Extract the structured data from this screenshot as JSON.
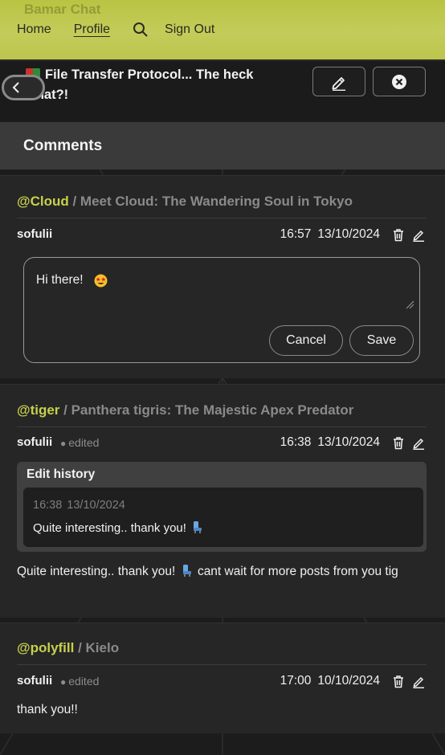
{
  "nav": {
    "ghost_text": "Bamar Chat",
    "links": [
      "Home",
      "Profile"
    ],
    "sign_out": "Sign Out",
    "accent": "#c3cc5a"
  },
  "post": {
    "title": "File Transfer Protocol... The heck what?!"
  },
  "comments_section": {
    "title": "Comments"
  },
  "comments": [
    {
      "tag": "@Cloud",
      "post_title": "Meet Cloud: The Wandering Soul in Tokyo",
      "author": "sofulii",
      "edited": "",
      "time": "16:57",
      "date": "13/10/2024",
      "editing": {
        "value": "Hi there!",
        "cancel_label": "Cancel",
        "save_label": "Save"
      }
    },
    {
      "tag": "@tiger",
      "post_title": "Panthera tigris: The Majestic Apex Predator",
      "author": "sofulii",
      "edited": "edited",
      "time": "16:38",
      "date": "13/10/2024",
      "history": {
        "title": "Edit history",
        "entries": [
          {
            "time": "16:38",
            "date": "13/10/2024",
            "text": "Quite interesting.. thank you!"
          }
        ]
      },
      "body_before": "Quite interesting.. thank you!",
      "body_after": "cant wait for more posts from you tig"
    },
    {
      "tag": "@polyfill",
      "post_title": "Kielo",
      "author": "sofulii",
      "edited": "edited",
      "time": "17:00",
      "date": "10/10/2024",
      "body": "thank you!!"
    }
  ]
}
